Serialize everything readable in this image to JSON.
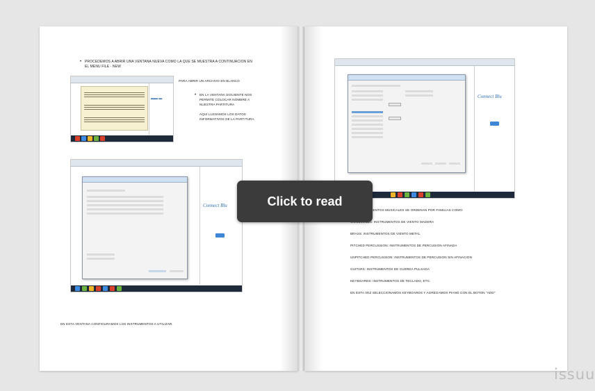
{
  "overlay": {
    "click_to_read": "Click to read"
  },
  "brand": {
    "logo_text": "issuu"
  },
  "left_page": {
    "bullet1_line1": "PROCEDEMOS A ABRIR UNA VENTANA NUEVA COMO LA QUE SE MUESTRA A CONTINUACION EN",
    "bullet1_line2": "EL MENU FILE - NEW",
    "note_open": "PARA ABRIR UN ARCHIVO EN BLANCO",
    "bullet2_line1": "EN LA VENTANA SIGUIENTE NOS",
    "bullet2_line2": "PERMITE COLOCAR NOMBRE A",
    "bullet2_line3": "NUESTRA PARTITURA",
    "note2_line1": "AQUÍ LLENAMOS LOS DATOS",
    "note2_line2": "INFORMATIVOS DE LA PARTITURA",
    "footer_text": "EN ESTA VENTANA CONFIGURAMOS LOS INSTRUMENTOS A UTILIZAR."
  },
  "right_page": {
    "lines": [
      "LOS INSTRUMENTOS MUSICALES SE ORDENAN POR FAMILIAS COMO:",
      "WOODWINDS: INSTRUMENTOS DE VIENTO MADERA",
      "BRASS: INSTRUMENTOS DE VIENTO METAL",
      "PITCHED PERCUSSION: INSTRUMENTOS DE PERCUSION AFINADA",
      "UNPITCHED PERCUSSION: INSTRUMENTOS DE PERCUSION SIN AFINACION",
      "GUITARS: INSTRUMENTOS DE CUERDA PULSADA",
      "KEYBOARDS: INSTRUMENTOS DE TECLADO, ETC.",
      "EN ESTA VEZ SELECCIONAMOS KEYBOARDS Y AGREGAMOS PIANO CON EL BOTON \"ADD\""
    ]
  },
  "colors": {
    "background": "#e6e6e6",
    "page": "#ffffff",
    "overlay": "#3b3b3b",
    "accent_blue": "#2d6fb5",
    "brand_gray": "#bdbdbd"
  }
}
